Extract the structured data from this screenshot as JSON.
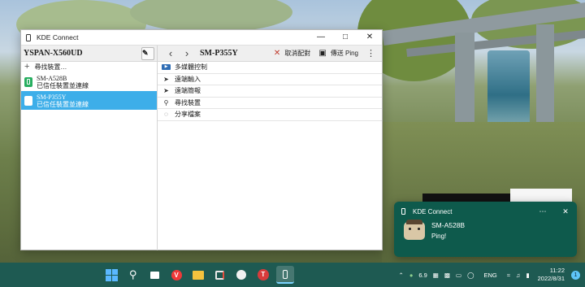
{
  "window": {
    "title": "KDE Connect",
    "this_device": "YSPAN-X560UD",
    "find_devices": "尋找裝置…",
    "devices": [
      {
        "name": "SM-A528B",
        "status": "已信任裝置並連線",
        "selected": false
      },
      {
        "name": "SM-P355Y",
        "status": "已信任裝置並連線",
        "selected": true
      }
    ],
    "device_title": "SM-P355Y",
    "unpair_label": "取消配對",
    "ping_label": "傳送 Ping",
    "plugins": [
      {
        "icon": "media-control-icon",
        "label": "多媒體控制"
      },
      {
        "icon": "cursor-icon",
        "label": "遠端輸入"
      },
      {
        "icon": "cursor-icon",
        "label": "遠端簡報"
      },
      {
        "icon": "search-icon",
        "label": "尋找裝置"
      },
      {
        "icon": "share-icon",
        "label": "分享檔案"
      }
    ]
  },
  "notification": {
    "app": "KDE Connect",
    "title": "SM-A528B",
    "body": "Ping!"
  },
  "taskbar": {
    "apps": [
      "start-icon",
      "search-icon",
      "task-view-icon",
      "vivaldi-icon",
      "file-explorer-icon",
      "snipping-icon",
      "3d-app-icon",
      "t-app-icon",
      "kde-connect-icon"
    ],
    "tray": {
      "battery_text": "6.9",
      "lang": "ENG",
      "time": "11:22",
      "date": "2022/8/31",
      "notification_count": "1"
    }
  }
}
